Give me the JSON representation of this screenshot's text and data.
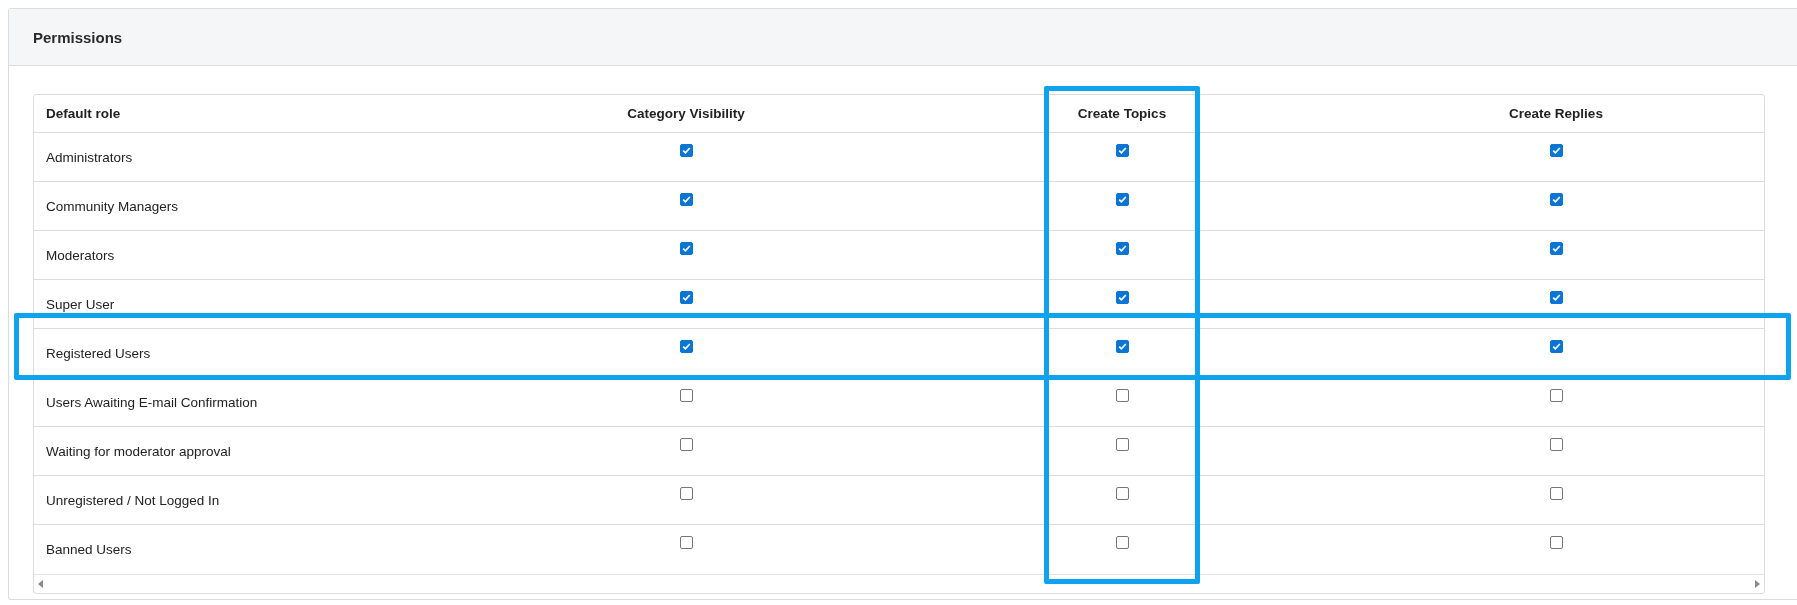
{
  "panel": {
    "title": "Permissions"
  },
  "table": {
    "columns": [
      {
        "label": "Default role",
        "highlighted": false
      },
      {
        "label": "Category Visibility",
        "highlighted": false
      },
      {
        "label": "Create Topics",
        "highlighted": true
      },
      {
        "label": "Create Replies",
        "highlighted": false
      }
    ],
    "rows": [
      {
        "role": "Administrators",
        "checks": [
          true,
          true,
          true
        ],
        "highlighted": false
      },
      {
        "role": "Community Managers",
        "checks": [
          true,
          true,
          true
        ],
        "highlighted": false
      },
      {
        "role": "Moderators",
        "checks": [
          true,
          true,
          true
        ],
        "highlighted": false
      },
      {
        "role": "Super User",
        "checks": [
          true,
          true,
          true
        ],
        "highlighted": false
      },
      {
        "role": "Registered Users",
        "checks": [
          true,
          true,
          true
        ],
        "highlighted": true
      },
      {
        "role": "Users Awaiting E-mail Confirmation",
        "checks": [
          false,
          false,
          false
        ],
        "highlighted": false
      },
      {
        "role": "Waiting for moderator approval",
        "checks": [
          false,
          false,
          false
        ],
        "highlighted": false
      },
      {
        "role": "Unregistered / Not Logged In",
        "checks": [
          false,
          false,
          false
        ],
        "highlighted": false
      },
      {
        "role": "Banned Users",
        "checks": [
          false,
          false,
          false
        ],
        "highlighted": false
      }
    ]
  }
}
